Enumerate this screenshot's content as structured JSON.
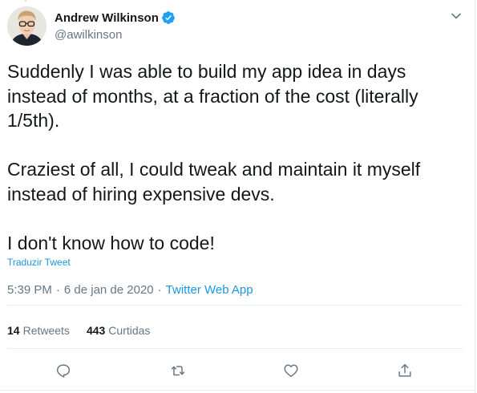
{
  "author": {
    "name": "Andrew Wilkinson",
    "handle": "@awilkinson",
    "verified": true
  },
  "tweet": {
    "paragraphs": [
      "Suddenly I was able to build my app idea in days instead of months, at a fraction of the cost (literally 1/5th).",
      "Craziest of all, I could tweak and maintain it myself instead of hiring expensive devs.",
      "I don't know how to code!"
    ],
    "translate_label": "Traduzir Tweet",
    "time": "5:39 PM",
    "separator": "·",
    "date": "6 de jan de 2020",
    "source": "Twitter Web App"
  },
  "stats": {
    "retweets_count": "14",
    "retweets_label": "Retweets",
    "likes_count": "443",
    "likes_label": "Curtidas"
  },
  "actions": [
    {
      "icon": "reply-icon"
    },
    {
      "icon": "retweet-icon"
    },
    {
      "icon": "like-icon"
    },
    {
      "icon": "share-icon"
    }
  ],
  "colors": {
    "link": "#1b95e0",
    "secondary_text": "#657786",
    "primary_text": "#14171a",
    "divider": "#e6ecf0",
    "verified": "#1da1f2"
  }
}
